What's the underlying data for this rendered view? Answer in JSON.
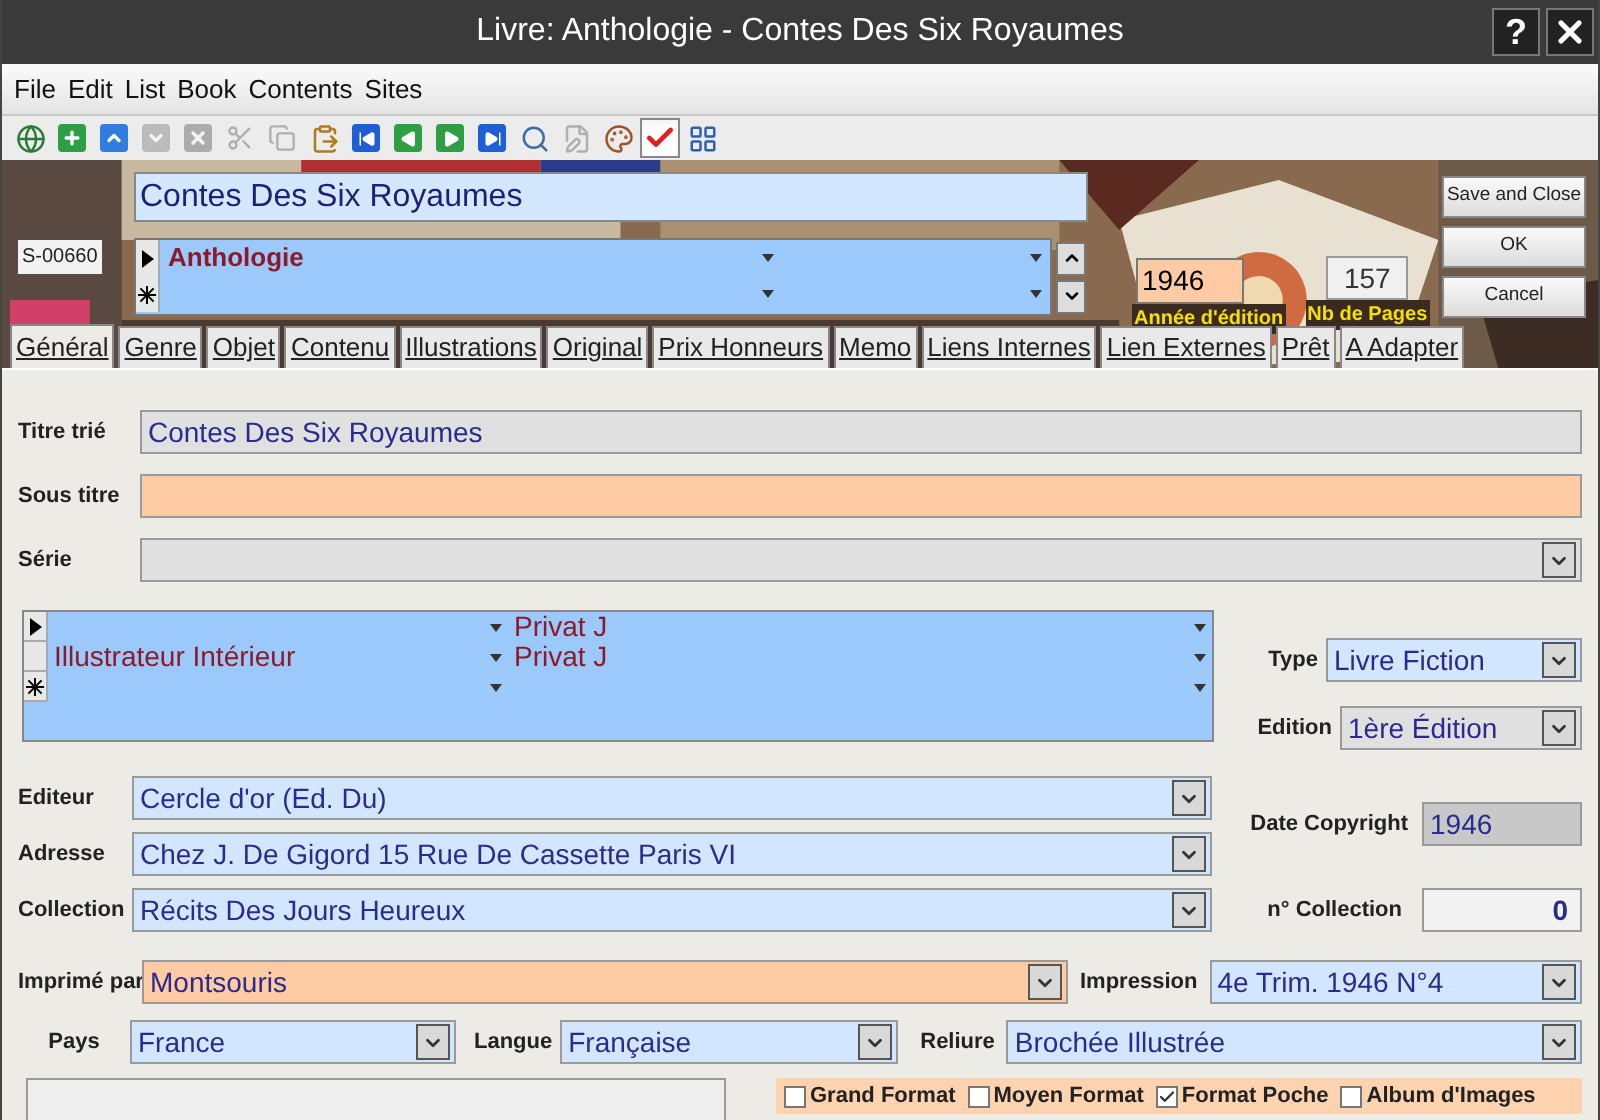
{
  "window": {
    "title": "Livre: Anthologie - Contes Des Six Royaumes",
    "help": "?"
  },
  "menu": [
    "File",
    "Edit",
    "List",
    "Book",
    "Contents",
    "Sites"
  ],
  "toolbar": [
    {
      "kind": "globe",
      "disabled": false,
      "selected": false
    },
    {
      "kind": "add",
      "disabled": false,
      "selected": false
    },
    {
      "kind": "up",
      "disabled": false,
      "selected": false
    },
    {
      "kind": "down",
      "disabled": true,
      "selected": false
    },
    {
      "kind": "delete",
      "disabled": true,
      "selected": false
    },
    {
      "kind": "cut",
      "disabled": true,
      "selected": false
    },
    {
      "kind": "copy",
      "disabled": true,
      "selected": false
    },
    {
      "kind": "paste",
      "disabled": false,
      "selected": false
    },
    {
      "kind": "first",
      "disabled": false,
      "selected": false
    },
    {
      "kind": "prev",
      "disabled": false,
      "selected": false
    },
    {
      "kind": "next",
      "disabled": false,
      "selected": false
    },
    {
      "kind": "last",
      "disabled": false,
      "selected": false
    },
    {
      "kind": "search",
      "disabled": false,
      "selected": false
    },
    {
      "kind": "edit",
      "disabled": true,
      "selected": false
    },
    {
      "kind": "palette",
      "disabled": false,
      "selected": false
    },
    {
      "kind": "check",
      "disabled": false,
      "selected": true
    },
    {
      "kind": "grid",
      "disabled": false,
      "selected": false
    }
  ],
  "header": {
    "code": "S-00660",
    "title": "Contes Des Six Royaumes",
    "authors": [
      {
        "kind": "current",
        "role": "Anthologie"
      },
      {
        "kind": "new"
      }
    ],
    "year": {
      "value": "1946",
      "label": "Année d'édition"
    },
    "pages": {
      "value": "157",
      "label": "Nb de Pages"
    }
  },
  "buttons": [
    "Save and Close",
    "OK",
    "Cancel"
  ],
  "tabs": [
    {
      "label": "Général",
      "selected": true
    },
    {
      "label": "Genre",
      "selected": false
    },
    {
      "label": "Objet",
      "selected": false
    },
    {
      "label": "Contenu",
      "selected": false
    },
    {
      "label": "Illustrations",
      "selected": false
    },
    {
      "label": "Original",
      "selected": false
    },
    {
      "label": "Prix Honneurs",
      "selected": false
    },
    {
      "label": "Memo",
      "selected": false
    },
    {
      "label": "Liens Internes",
      "selected": false
    },
    {
      "label": "Lien Externes",
      "selected": false
    },
    {
      "label": "Prêt",
      "selected": false
    },
    {
      "label": "A Adapter",
      "selected": false
    }
  ],
  "form": {
    "sort_title": {
      "label": "Titre trié",
      "value": "Contes Des Six Royaumes"
    },
    "subtitle": {
      "label": "Sous titre"
    },
    "series": {
      "label": "Série"
    },
    "contributors": [
      {
        "kind": "current",
        "name": "Privat J"
      },
      {
        "kind": "plain",
        "role": "Illustrateur Intérieur",
        "name": "Privat J"
      },
      {
        "kind": "new"
      }
    ],
    "type": {
      "label": "Type",
      "value": "Livre Fiction"
    },
    "edition": {
      "label": "Edition",
      "value": "1ère Édition"
    },
    "publisher": {
      "label": "Editeur",
      "value": "Cercle d'or (Ed. Du)"
    },
    "address": {
      "label": "Adresse",
      "value": "Chez J. De Gigord 15 Rue De Cassette Paris VI"
    },
    "collection": {
      "label": "Collection",
      "value": "Récits Des Jours Heureux"
    },
    "copyright": {
      "label": "Date Copyright",
      "value": "1946"
    },
    "collection_number": {
      "label": "n° Collection",
      "value": "0"
    },
    "printer": {
      "label": "Imprimé par",
      "value": "Montsouris"
    },
    "printing": {
      "label": "Impression",
      "value": "4e Trim. 1946 N°4"
    },
    "country": {
      "label": "Pays",
      "value": "France"
    },
    "language": {
      "label": "Langue",
      "value": "Française"
    },
    "binding": {
      "label": "Reliure",
      "value": "Brochée Illustrée"
    }
  },
  "formats": [
    {
      "label": "Grand Format",
      "checked": false
    },
    {
      "label": "Moyen Format",
      "checked": false
    },
    {
      "label": "Format Poche",
      "checked": true
    },
    {
      "label": "Album d'Images",
      "checked": false
    }
  ]
}
